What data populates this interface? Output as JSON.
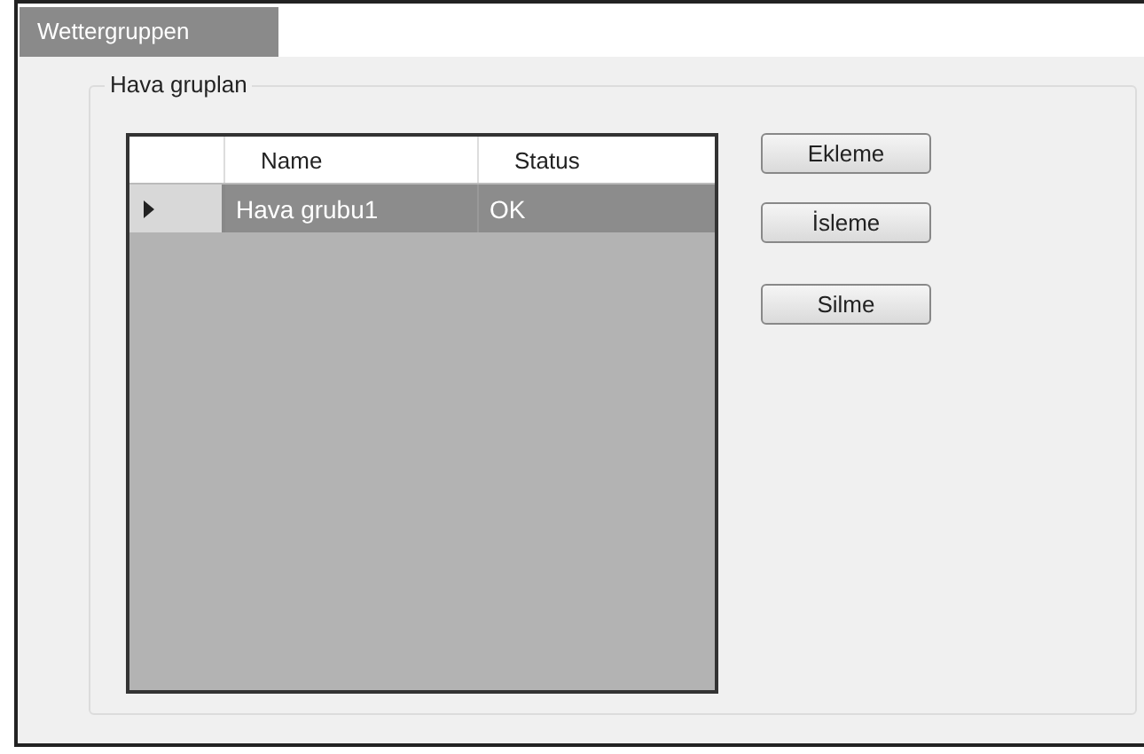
{
  "tabs": [
    {
      "label": "Wettergruppen",
      "selected": true
    }
  ],
  "group": {
    "title": "Hava gruplan",
    "table": {
      "columns": [
        "Name",
        "Status"
      ],
      "rows": [
        {
          "cells": [
            "Hava grubu1",
            "OK"
          ],
          "selected": true
        }
      ]
    },
    "buttons": [
      "Ekleme",
      "İsleme",
      "Silme"
    ]
  }
}
